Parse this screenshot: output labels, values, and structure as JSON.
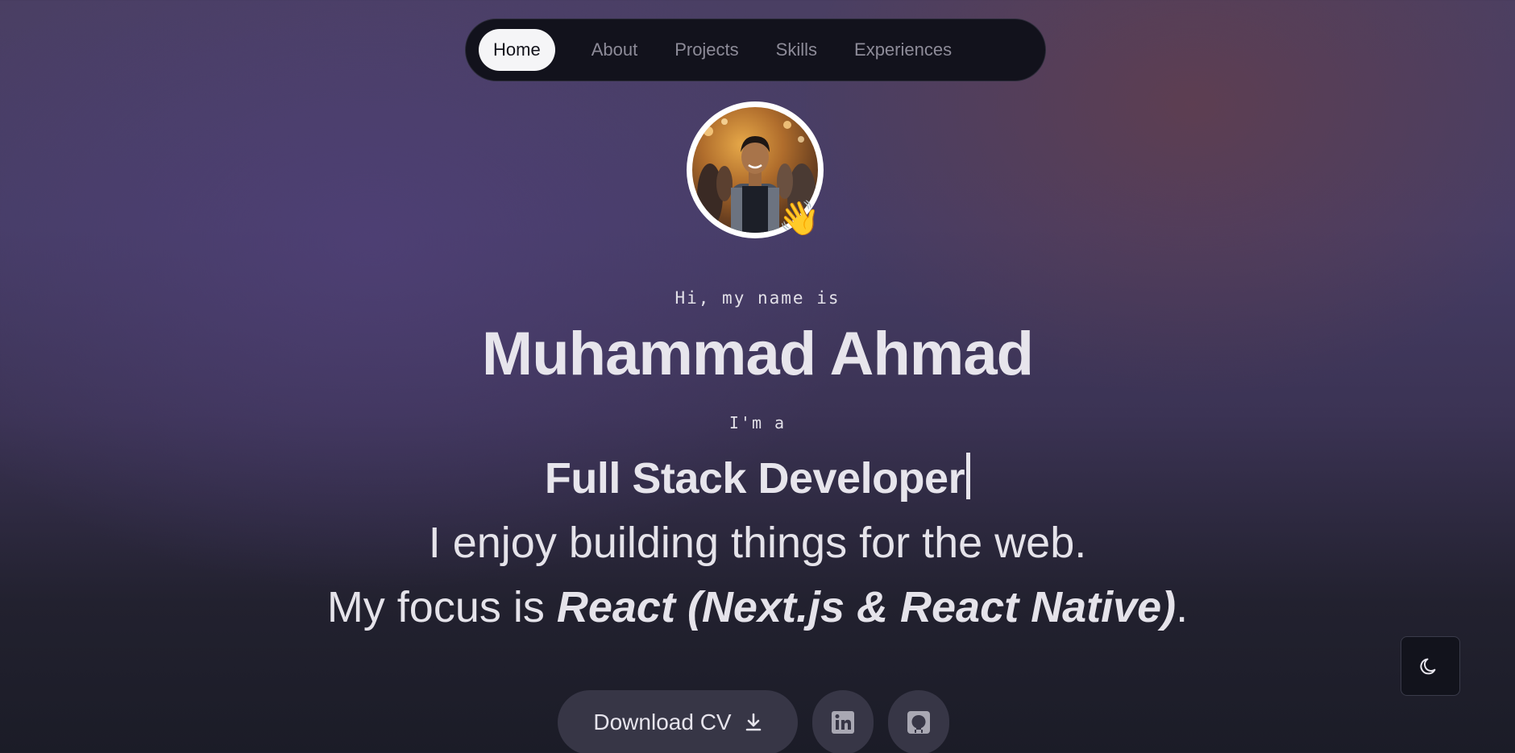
{
  "nav": {
    "items": [
      {
        "label": "Home",
        "active": true
      },
      {
        "label": "About",
        "active": false
      },
      {
        "label": "Projects",
        "active": false
      },
      {
        "label": "Skills",
        "active": false
      },
      {
        "label": "Experiences",
        "active": false
      }
    ]
  },
  "hero": {
    "greeting": "Hi, my name is",
    "name": "Muhammad Ahmad",
    "im_a": "I'm a",
    "role": "Full Stack Developer",
    "line1": "I enjoy building things for the web.",
    "line2_prefix": "My focus is ",
    "line2_emphasis": "React (Next.js & React Native)",
    "line2_suffix": "."
  },
  "avatar": {
    "emoji": "👋"
  },
  "actions": {
    "download_cv": "Download CV",
    "download_icon": "download-icon",
    "linkedin_icon": "linkedin-icon",
    "github_icon": "github-icon"
  },
  "theme_toggle": {
    "icon": "moon-icon"
  },
  "colors": {
    "nav_bg": "#12121c",
    "active_pill": "#f5f5f7",
    "button_bg": "#373646",
    "text": "#e5e3ea"
  }
}
